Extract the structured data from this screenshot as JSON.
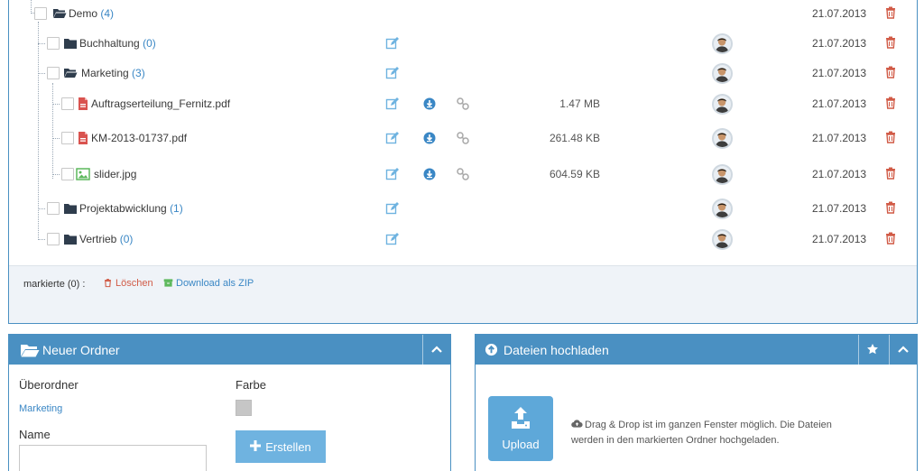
{
  "tree": {
    "rows": [
      {
        "name": "Demo",
        "count": "(4)",
        "kind": "folder-open",
        "date": "21.07.2013",
        "size": "",
        "edit": false,
        "download": false,
        "link": false,
        "avatar": false
      },
      {
        "name": "Buchhaltung",
        "count": "(0)",
        "kind": "folder",
        "date": "21.07.2013",
        "size": "",
        "edit": true,
        "download": false,
        "link": false,
        "avatar": true
      },
      {
        "name": "Marketing",
        "count": "(3)",
        "kind": "folder-open",
        "date": "21.07.2013",
        "size": "",
        "edit": true,
        "download": false,
        "link": false,
        "avatar": true
      },
      {
        "name": "Auftragserteilung_Fernitz.pdf",
        "count": "",
        "kind": "pdf",
        "date": "21.07.2013",
        "size": "1.47 MB",
        "edit": true,
        "download": true,
        "link": true,
        "avatar": true
      },
      {
        "name": "KM-2013-01737.pdf",
        "count": "",
        "kind": "pdf",
        "date": "21.07.2013",
        "size": "261.48 KB",
        "edit": true,
        "download": true,
        "link": true,
        "avatar": true
      },
      {
        "name": "slider.jpg",
        "count": "",
        "kind": "image",
        "date": "21.07.2013",
        "size": "604.59 KB",
        "edit": true,
        "download": true,
        "link": true,
        "avatar": true
      },
      {
        "name": "Projektabwicklung",
        "count": "(1)",
        "kind": "folder",
        "date": "21.07.2013",
        "size": "",
        "edit": true,
        "download": false,
        "link": false,
        "avatar": true
      },
      {
        "name": "Vertrieb",
        "count": "(0)",
        "kind": "folder",
        "date": "21.07.2013",
        "size": "",
        "edit": true,
        "download": false,
        "link": false,
        "avatar": true
      }
    ],
    "footer": {
      "selected_label": "markierte (0) :",
      "delete_label": "Löschen",
      "zip_label": "Download als ZIP"
    }
  },
  "new_folder": {
    "title": "Neuer Ordner",
    "parent_label": "Überordner",
    "parent_value": "Marketing",
    "color_label": "Farbe",
    "color_value": "#c6c6c6",
    "name_label": "Name",
    "name_value": "",
    "create_label": "Erstellen"
  },
  "upload": {
    "title": "Dateien hochladen",
    "button_label": "Upload",
    "hint": "Drag & Drop ist im ganzen Fenster möglich. Die Dateien werden in den markierten Ordner hochgeladen."
  },
  "colors": {
    "accent": "#4a90c2",
    "link": "#3a87c5",
    "danger": "#d15b47",
    "success": "#5cb85c",
    "folder": "#2f3d4d"
  }
}
